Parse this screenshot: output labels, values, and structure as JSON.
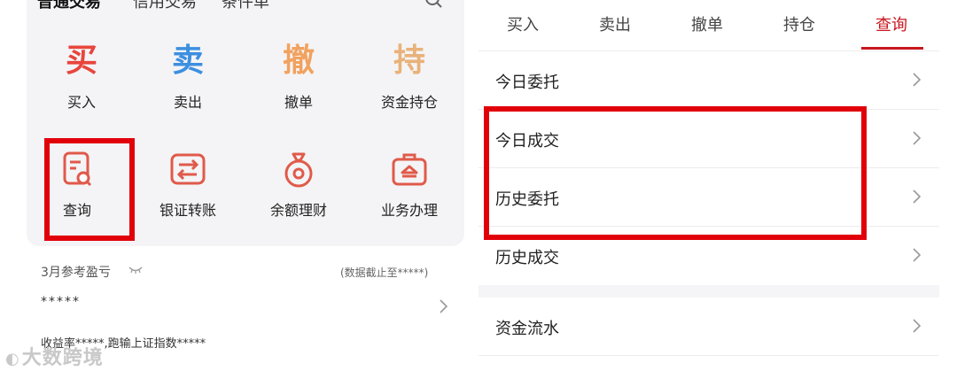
{
  "left": {
    "top_tabs": [
      "普通交易",
      "信用交易",
      "条件单"
    ],
    "grid": [
      {
        "label": "买入",
        "glyph": "买",
        "color": "#e8453c"
      },
      {
        "label": "卖出",
        "glyph": "卖",
        "color": "#3d8fe0"
      },
      {
        "label": "撤单",
        "glyph": "撤",
        "color": "#f1a25f"
      },
      {
        "label": "资金持仓",
        "glyph": "持",
        "color": "#e9b27a"
      },
      {
        "label": "查询",
        "icon": "query-icon"
      },
      {
        "label": "银证转账",
        "icon": "transfer-icon"
      },
      {
        "label": "余额理财",
        "icon": "money-bag-icon"
      },
      {
        "label": "业务办理",
        "icon": "briefcase-icon"
      }
    ],
    "pnl": {
      "title": "3月参考盈亏",
      "note": "(数据截止至*****)",
      "value": "*****",
      "rate": "收益率*****,跑输上证指数*****"
    },
    "watermark": "大数跨境"
  },
  "right": {
    "tabs": [
      "买入",
      "卖出",
      "撤单",
      "持仓",
      "查询"
    ],
    "active_tab": "查询",
    "rows": [
      "今日委托",
      "今日成交",
      "历史委托",
      "历史成交",
      "资金流水"
    ]
  },
  "colors": {
    "accent": "#c8161d",
    "highlight": "#e1000a",
    "icon_red": "#e05a4a"
  }
}
